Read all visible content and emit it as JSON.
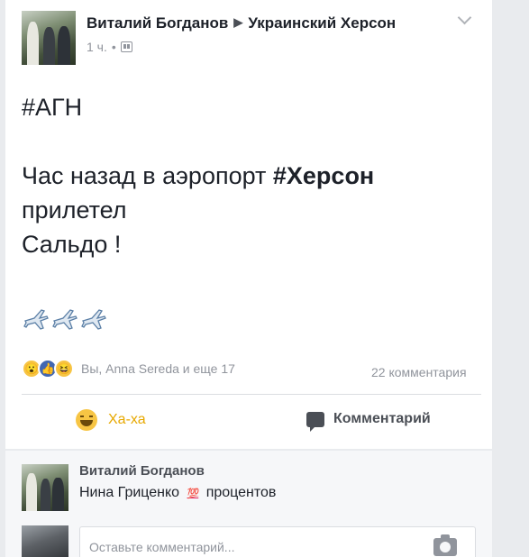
{
  "post": {
    "author": "Виталий Богданов",
    "group": "Украинский Херсон",
    "time": "1 ч.",
    "text": {
      "line1": "#АГН",
      "line2_prefix": "Час назад в аэропорт ",
      "line2_tag": "#Херсон",
      "line3": "прилетел",
      "line4": "Сальдо !"
    },
    "emoji_icons": [
      "airplane-icon",
      "airplane-icon",
      "airplane-icon"
    ]
  },
  "reactions": {
    "icons": [
      "wow-reaction-icon",
      "like-reaction-icon",
      "haha-reaction-icon"
    ],
    "summary": "Вы, Anna Sereda и еще 17",
    "comments_count": "22 комментария"
  },
  "actions": {
    "haha_label": "Ха-ха",
    "comment_label": "Комментарий"
  },
  "comment": {
    "author": "Виталий Богданов",
    "text_before": "Нина Гриценко",
    "emoji": "💯",
    "text_after": "процентов"
  },
  "reply": {
    "placeholder": "Оставьте комментарий..."
  },
  "colors": {
    "background": "#e9ebee",
    "card": "#ffffff",
    "haha_accent": "#e7a800",
    "like_blue": "#4267b2"
  }
}
